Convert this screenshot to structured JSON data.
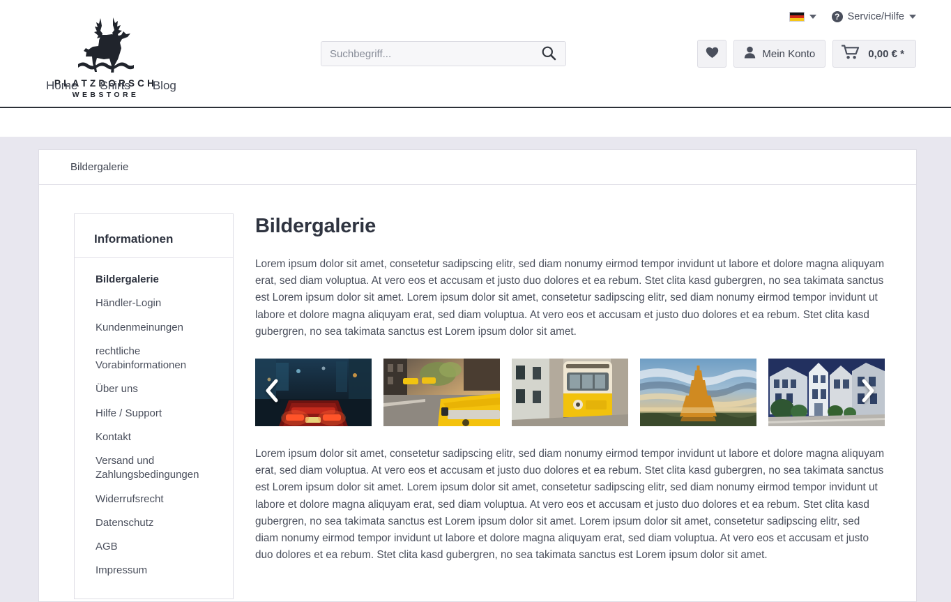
{
  "brand": {
    "name": "PLATZDORSCH",
    "subtitle": "WEBSTORE",
    "logo_icon": "deer-stag-silhouette-icon"
  },
  "topbar": {
    "language": {
      "label": "Deutsch",
      "flag": "german-flag-icon"
    },
    "service": {
      "label": "Service/Hilfe",
      "icon": "question-circle-icon"
    }
  },
  "search": {
    "placeholder": "Suchbegriff...",
    "value": "",
    "icon": "search-icon"
  },
  "account": {
    "wishlist_icon": "heart-icon",
    "account_icon": "user-icon",
    "account_label": "Mein Konto",
    "cart_icon": "shopping-cart-icon",
    "cart_total": "0,00 € *"
  },
  "nav": {
    "items": [
      {
        "label": "Home"
      },
      {
        "label": "Shirts"
      },
      {
        "label": "Blog"
      }
    ]
  },
  "breadcrumb": {
    "current": "Bildergalerie"
  },
  "sidebar": {
    "title": "Informationen",
    "items": [
      {
        "label": "Bildergalerie",
        "active": true
      },
      {
        "label": "Händler-Login",
        "active": false
      },
      {
        "label": "Kundenmeinungen",
        "active": false
      },
      {
        "label": "rechtliche Vorabinformationen",
        "active": false
      },
      {
        "label": "Über uns",
        "active": false
      },
      {
        "label": "Hilfe / Support",
        "active": false
      },
      {
        "label": "Kontakt",
        "active": false
      },
      {
        "label": "Versand und Zahlungsbedingungen",
        "active": false
      },
      {
        "label": "Widerrufsrecht",
        "active": false
      },
      {
        "label": "Datenschutz",
        "active": false
      },
      {
        "label": "AGB",
        "active": false
      },
      {
        "label": "Impressum",
        "active": false
      }
    ]
  },
  "main": {
    "title": "Bildergalerie",
    "paragraph_1": "Lorem ipsum dolor sit amet, consetetur sadipscing elitr, sed diam nonumy eirmod tempor invidunt ut labore et dolore magna aliquyam erat, sed diam voluptua. At vero eos et accusam et justo duo dolores et ea rebum. Stet clita kasd gubergren, no sea takimata sanctus est Lorem ipsum dolor sit amet. Lorem ipsum dolor sit amet, consetetur sadipscing elitr, sed diam nonumy eirmod tempor invidunt ut labore et dolore magna aliquyam erat, sed diam voluptua. At vero eos et accusam et justo duo dolores et ea rebum. Stet clita kasd gubergren, no sea takimata sanctus est Lorem ipsum dolor sit amet.",
    "paragraph_2": "Lorem ipsum dolor sit amet, consetetur sadipscing elitr, sed diam nonumy eirmod tempor invidunt ut labore et dolore magna aliquyam erat, sed diam voluptua. At vero eos et accusam et justo duo dolores et ea rebum. Stet clita kasd gubergren, no sea takimata sanctus est Lorem ipsum dolor sit amet. Lorem ipsum dolor sit amet, consetetur sadipscing elitr, sed diam nonumy eirmod tempor invidunt ut labore et dolore magna aliquyam erat, sed diam voluptua. At vero eos et accusam et justo duo dolores et ea rebum. Stet clita kasd gubergren, no sea takimata sanctus est Lorem ipsum dolor sit amet. Lorem ipsum dolor sit amet, consetetur sadipscing elitr, sed diam nonumy eirmod tempor invidunt ut labore et dolore magna aliquyam erat, sed diam voluptua. At vero eos et accusam et justo duo dolores et ea rebum. Stet clita kasd gubergren, no sea takimata sanctus est Lorem ipsum dolor sit amet."
  },
  "gallery": {
    "prev_icon": "chevron-left-icon",
    "next_icon": "chevron-right-icon",
    "images": [
      {
        "description": "Sports car taillights on wet night city street"
      },
      {
        "description": "Yellow taxi cab on sunny city street"
      },
      {
        "description": "Yellow vintage tram on narrow Lisbon street"
      },
      {
        "description": "Eiffel Tower at sunset with dramatic clouds"
      },
      {
        "description": "San Francisco Victorian houses on a hill"
      }
    ]
  },
  "colors": {
    "page_background": "#e8e7ef",
    "card_background": "#ffffff",
    "text": "#4a4f5c",
    "heading": "#2f3440",
    "border": "#dedde5",
    "nav_underline": "#2c3038"
  }
}
